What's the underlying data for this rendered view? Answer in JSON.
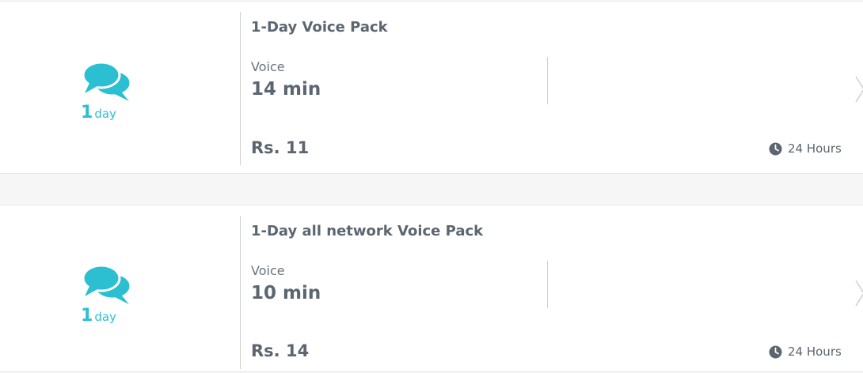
{
  "colors": {
    "accent": "#2bbfd1",
    "text": "#5c6670",
    "divider": "#cfcfcf",
    "background": "#f6f6f6",
    "card": "#ffffff"
  },
  "packs": [
    {
      "icon": "chat-bubbles-icon",
      "duration_number": "1",
      "duration_unit": "day",
      "title": "1-Day Voice Pack",
      "benefit_label": "Voice",
      "benefit_value": "14 min",
      "price": "Rs. 11",
      "validity": "24 Hours"
    },
    {
      "icon": "chat-bubbles-icon",
      "duration_number": "1",
      "duration_unit": "day",
      "title": "1-Day all network Voice Pack",
      "benefit_label": "Voice",
      "benefit_value": "10 min",
      "price": "Rs. 14",
      "validity": "24 Hours"
    }
  ]
}
